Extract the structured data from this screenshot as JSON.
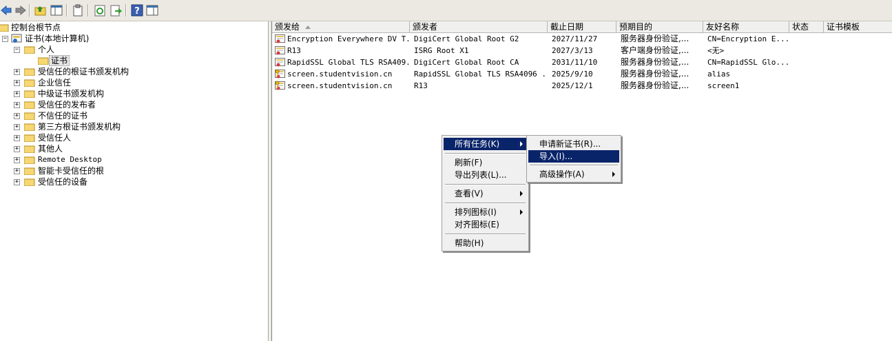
{
  "toolbar": {
    "buttons": [
      {
        "icon": "back-arrow-icon"
      },
      {
        "icon": "forward-arrow-icon"
      },
      {
        "icon": "up-folder-icon"
      },
      {
        "icon": "show-hide-tree-icon"
      },
      {
        "icon": "clipboard-icon"
      },
      {
        "icon": "refresh-icon"
      },
      {
        "icon": "export-list-icon"
      },
      {
        "icon": "help-icon"
      },
      {
        "icon": "action-pane-icon"
      }
    ]
  },
  "tree": {
    "root": "控制台根节点",
    "cert_store": "证书(本地计算机)",
    "personal": "个人",
    "certificates": "证书",
    "items": [
      "受信任的根证书颁发机构",
      "企业信任",
      "中级证书颁发机构",
      "受信任的发布者",
      "不信任的证书",
      "第三方根证书颁发机构",
      "受信任人",
      "其他人",
      "Remote Desktop",
      "智能卡受信任的根",
      "受信任的设备"
    ]
  },
  "list": {
    "columns": [
      "颁发给",
      "颁发者",
      "截止日期",
      "预期目的",
      "友好名称",
      "状态",
      "证书模板"
    ],
    "rows": [
      {
        "issued_to": "Encryption Everywhere DV T...",
        "issued_by": "DigiCert Global Root G2",
        "expires": "2027/11/27",
        "purpose": "服务器身份验证,...",
        "friendly": "CN=Encryption E...",
        "key": false
      },
      {
        "issued_to": "R13",
        "issued_by": "ISRG Root X1",
        "expires": "2027/3/13",
        "purpose": "客户端身份验证,...",
        "friendly": "<无>",
        "key": false
      },
      {
        "issued_to": "RapidSSL Global TLS RSA409...",
        "issued_by": "DigiCert Global Root CA",
        "expires": "2031/11/10",
        "purpose": "服务器身份验证,...",
        "friendly": "CN=RapidSSL Glo...",
        "key": false
      },
      {
        "issued_to": "screen.studentvision.cn",
        "issued_by": "RapidSSL Global TLS RSA4096 ...",
        "expires": "2025/9/10",
        "purpose": "服务器身份验证,...",
        "friendly": "alias",
        "key": true
      },
      {
        "issued_to": "screen.studentvision.cn",
        "issued_by": "R13",
        "expires": "2025/12/1",
        "purpose": "服务器身份验证,...",
        "friendly": "screen1",
        "key": true
      }
    ]
  },
  "context_menu": {
    "all_tasks": "所有任务(K)",
    "refresh": "刷新(F)",
    "export_list": "导出列表(L)...",
    "view": "查看(V)",
    "arrange_icons": "排列图标(I)",
    "line_up_icons": "对齐图标(E)",
    "help": "帮助(H)"
  },
  "submenu": {
    "request_new": "申请新证书(R)...",
    "import": "导入(I)...",
    "advanced": "高级操作(A)"
  },
  "colors": {
    "menu_highlight": "#0a246a",
    "toolbar_bg": "#ece9e2"
  }
}
